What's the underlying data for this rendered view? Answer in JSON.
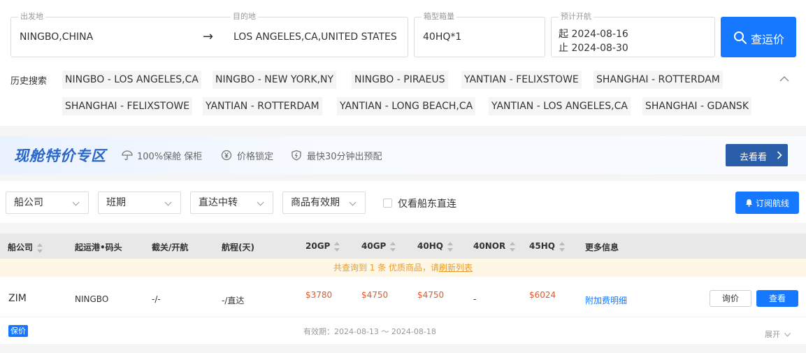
{
  "search": {
    "origin_label": "出发地",
    "origin_value": "NINGBO,CHINA",
    "arrow": "→",
    "dest_label": "目的地",
    "dest_value": "LOS ANGELES,CA,UNITED STATES",
    "container_label": "箱型箱量",
    "container_value": "40HQ*1",
    "sailing_label": "预计开航",
    "sailing_from": "起 2024-08-16",
    "sailing_to": "止 2024-08-30",
    "button_label": "查运价"
  },
  "history": {
    "label": "历史搜索",
    "items": [
      "NINGBO - LOS ANGELES,CA",
      "NINGBO - NEW YORK,NY",
      "NINGBO - PIRAEUS",
      "YANTIAN - FELIXSTOWE",
      "SHANGHAI - ROTTERDAM",
      "SHANGHAI - FELIXSTOWE",
      "YANTIAN - ROTTERDAM",
      "YANTIAN - LONG BEACH,CA",
      "YANTIAN - LOS ANGELES,CA",
      "SHANGHAI - GDANSK"
    ]
  },
  "banner": {
    "title": "现舱特价专区",
    "perk1": "100%保舱 保柜",
    "perk2": "价格锁定",
    "perk3": "最快30分钟出预配",
    "cta": "去看看"
  },
  "filters": {
    "carrier": "船公司",
    "schedule": "班期",
    "direct": "直达中转",
    "validity": "商品有效期",
    "owner_direct": "仅看船东直连",
    "subscribe": "订阅航线"
  },
  "table": {
    "headers": [
      "船公司",
      "起运港•码头",
      "截关/开航",
      "航程(天)",
      "20GP",
      "40GP",
      "40HQ",
      "40NOR",
      "45HQ",
      "更多信息"
    ],
    "notice_prefix": "共查询到 1 条 优质商品，请",
    "notice_link": "刷新列表",
    "rows": [
      {
        "carrier": "ZIM",
        "port": "NINGBO",
        "cutoff": "-/-",
        "transit": "-/直达",
        "p20gp": "$3780",
        "p40gp": "$4750",
        "p40hq": "$4750",
        "p40nor": "-",
        "p45hq": "$6024",
        "more": "附加费明细",
        "inquire": "询价",
        "view": "查看",
        "badge": "保价",
        "validity": "有效期：2024-08-13 ～ 2024-08-18",
        "expand": "展开"
      }
    ]
  },
  "colors": {
    "primary": "#1677ff",
    "banner_button": "#2b5ea8",
    "price": "#e4572e",
    "notice_bg": "#fff7e6",
    "notice_text": "#e89b2c"
  }
}
